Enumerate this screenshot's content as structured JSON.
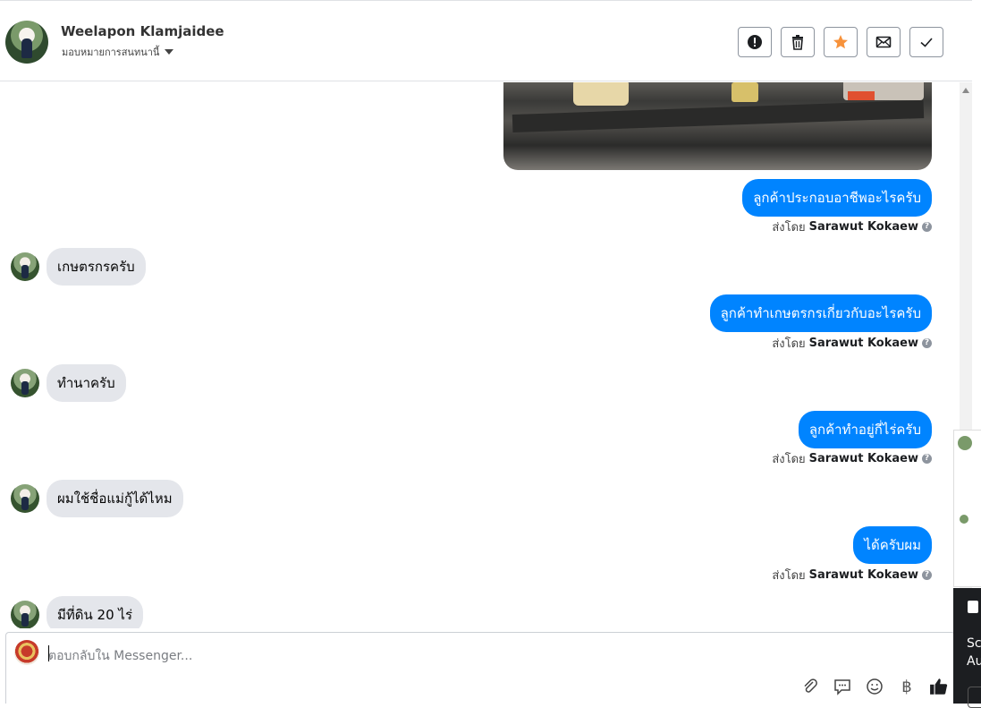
{
  "header": {
    "name": "Weelapon Klamjaidee",
    "subtitle": "มอบหมายการสนทนานี้",
    "actions": [
      "spam-icon",
      "trash-icon",
      "star-icon",
      "mail-icon",
      "check-icon"
    ]
  },
  "messages": [
    {
      "dir": "out",
      "text": "ลูกค้าประกอบอาชีพอะไรครับ",
      "sent_prefix": "ส่งโดย",
      "sent_by": "Sarawut Kokaew"
    },
    {
      "dir": "in",
      "text": "เกษตรกรครับ"
    },
    {
      "dir": "out",
      "text": "ลูกค้าทำเกษตรกรเกี่ยวกับอะไรครับ",
      "sent_prefix": "ส่งโดย",
      "sent_by": "Sarawut Kokaew"
    },
    {
      "dir": "in",
      "text": "ทำนาครับ"
    },
    {
      "dir": "out",
      "text": "ลูกค้าทำอยู่กี่ไร่ครับ",
      "sent_prefix": "ส่งโดย",
      "sent_by": "Sarawut Kokaew"
    },
    {
      "dir": "in",
      "text": "ผมใช้ชื่อแม่กู้ได้ไหม"
    },
    {
      "dir": "out",
      "text": "ได้ครับผม",
      "sent_prefix": "ส่งโดย",
      "sent_by": "Sarawut Kokaew"
    },
    {
      "dir": "in",
      "text": "มีที่ดิน 20 ไร่"
    }
  ],
  "composer": {
    "placeholder": "ตอบกลับใน Messenger...",
    "tools": [
      "paperclip-icon",
      "saved-reply-icon",
      "emoji-icon",
      "baht-icon",
      "like-icon"
    ]
  },
  "side_popup": {
    "text_line1": "Sc",
    "text_line2": "Au"
  }
}
